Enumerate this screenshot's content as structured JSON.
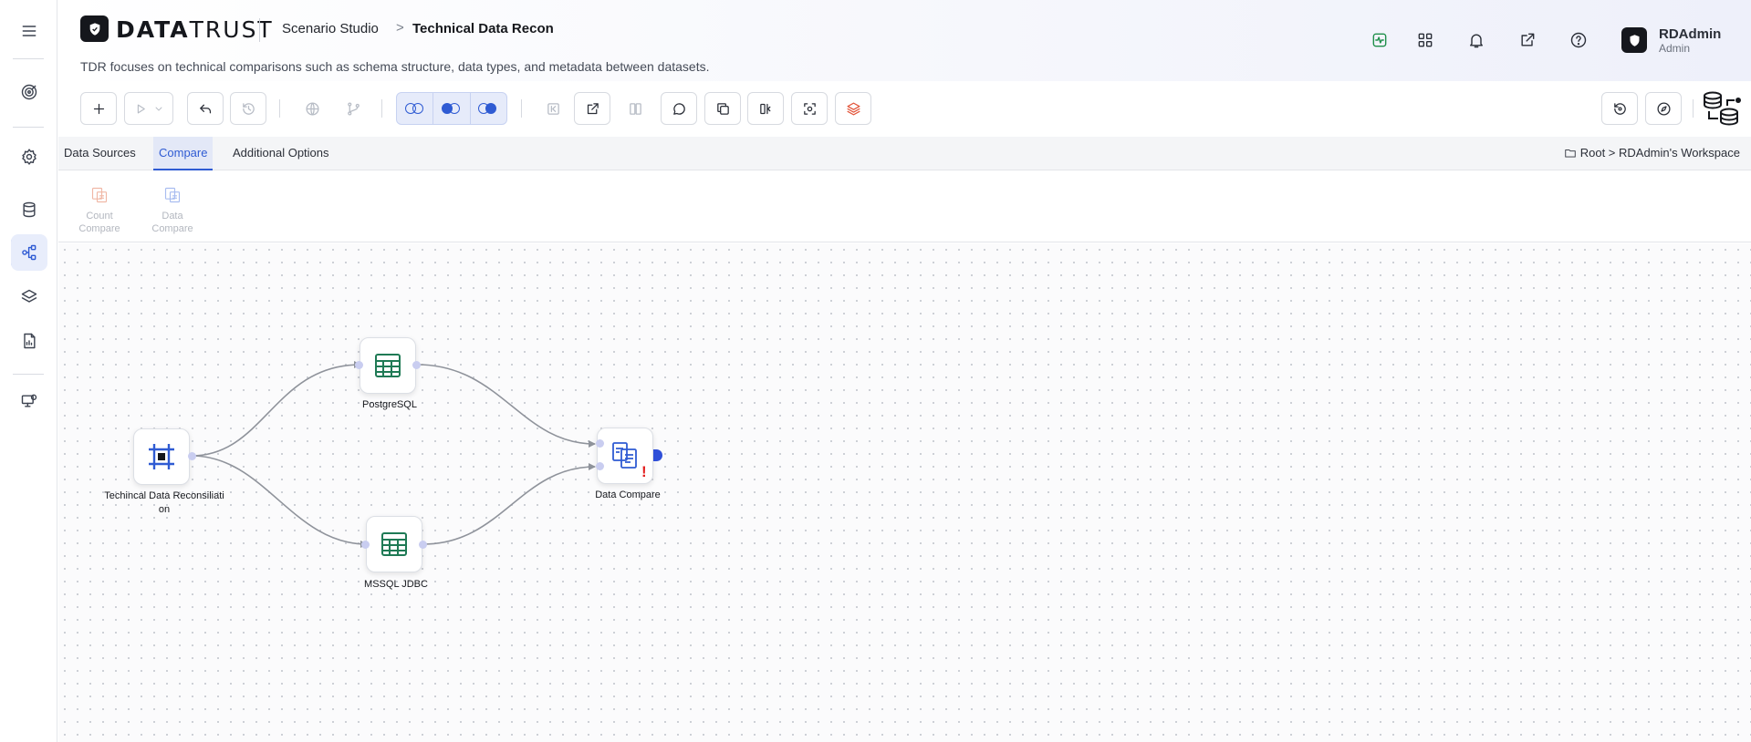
{
  "header": {
    "logo_text_strong": "DATA",
    "logo_text_light": "TRUST",
    "breadcrumb_studio": "Scenario Studio",
    "breadcrumb_separator": ">",
    "breadcrumb_current": "Technical Data Recon",
    "description": "TDR focuses on technical comparisons such as schema structure, data types, and metadata between datasets.",
    "user_name": "RDAdmin",
    "user_role": "Admin"
  },
  "tabs": [
    {
      "label": "Data Sources"
    },
    {
      "label": "Compare"
    },
    {
      "label": "Additional Options"
    }
  ],
  "workspace_path": "Root > RDAdmin's Workspace",
  "palette": [
    {
      "line1": "Count",
      "line2": "Compare"
    },
    {
      "line1": "Data",
      "line2": "Compare"
    }
  ],
  "nodes": [
    {
      "label_line1": "Techincal Data Reconsiliati",
      "label_line2": "on"
    },
    {
      "label_line1": "PostgreSQL"
    },
    {
      "label_line1": "MSSQL JDBC"
    },
    {
      "label_line1": "Data Compare"
    }
  ],
  "warning_mark": "!",
  "colors": {
    "accent": "#2f5bd3",
    "table_icon": "#1f7a55",
    "warning": "#e32020",
    "activity_icon": "#1f8f4a",
    "layers_icon": "#e2553a"
  }
}
